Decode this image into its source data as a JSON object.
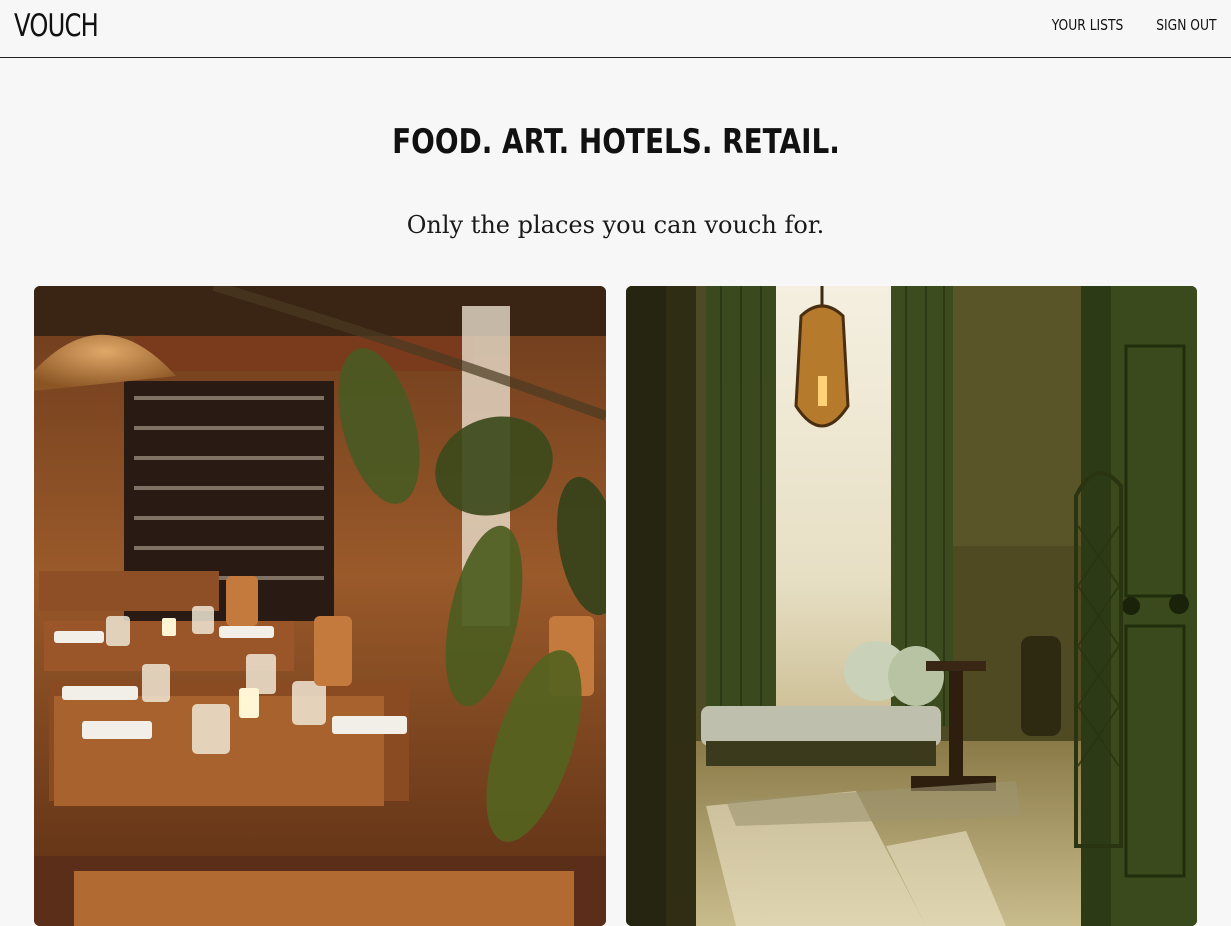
{
  "header": {
    "brand": "VOUCH",
    "nav": [
      {
        "label": "YOUR LISTS"
      },
      {
        "label": "SIGN OUT"
      }
    ]
  },
  "hero": {
    "headline": "FOOD. ART. HOTELS. RETAIL.",
    "tagline": "Only the places you can vouch for."
  },
  "cards": [
    {
      "name": "restaurant-photo"
    },
    {
      "name": "hotel-room-photo"
    }
  ]
}
